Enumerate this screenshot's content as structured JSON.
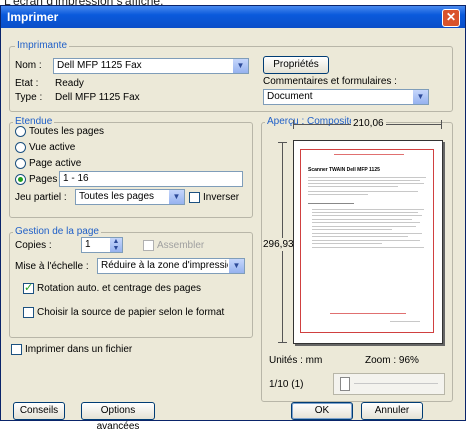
{
  "caption": "L'écran d'impression s'affiche.",
  "window": {
    "title": "Imprimer",
    "close_glyph": "✕"
  },
  "printer": {
    "group_title": "Imprimante",
    "name_label": "Nom :",
    "name_value": "Dell MFP 1125 Fax",
    "status_label": "Etat :",
    "status_value": "Ready",
    "type_label": "Type :",
    "type_value": "Dell MFP 1125 Fax",
    "properties_button": "Propriétés",
    "comments_label": "Commentaires et formulaires :",
    "comments_value": "Document"
  },
  "range": {
    "group_title": "Etendue",
    "all_pages": "Toutes les pages",
    "current_view": "Vue active",
    "current_page": "Page active",
    "pages_label": "Pages",
    "pages_value": "1 - 16",
    "subset_label": "Jeu partiel :",
    "subset_value": "Toutes les pages",
    "reverse_label": "Inverser"
  },
  "handling": {
    "group_title": "Gestion de la page",
    "copies_label": "Copies :",
    "copies_value": "1",
    "collate_label": "Assembler",
    "scaling_label": "Mise à l'échelle :",
    "scaling_value": "Réduire à la zone d'impression",
    "autorotate_label": "Rotation auto. et centrage des pages",
    "paper_source_label": "Choisir la source de papier selon le format"
  },
  "print_to_file": "Imprimer dans un fichier",
  "preview": {
    "title": "Aperçu : Composite",
    "width_value": "210,06",
    "height_value": "296,93",
    "units": "Unités : mm",
    "zoom": "Zoom : 96%",
    "page_indicator": "1/10 (1)",
    "doc_heading": "Scanner TWAIN Dell MFP 1125"
  },
  "buttons": {
    "advice": "Conseils",
    "advanced": "Options avancées",
    "ok": "OK",
    "cancel": "Annuler"
  },
  "icons": {
    "dropdown": "▼",
    "spin_up": "▲",
    "spin_down": "▼"
  },
  "colors": {
    "title_bar": "#0a4ec8",
    "group_title": "#2060c8",
    "preview_border": "#d04040"
  }
}
